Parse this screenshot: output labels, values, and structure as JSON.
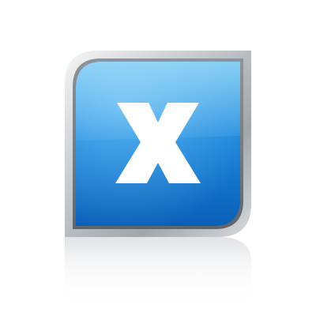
{
  "icon": {
    "name": "close-icon",
    "glyph": "X",
    "colors": {
      "frame_light": "#f4f5f6",
      "frame_dark": "#8e9498",
      "tile_top": "#43b2ee",
      "tile_bottom": "#0a5fb8",
      "glyph": "#ffffff"
    }
  }
}
